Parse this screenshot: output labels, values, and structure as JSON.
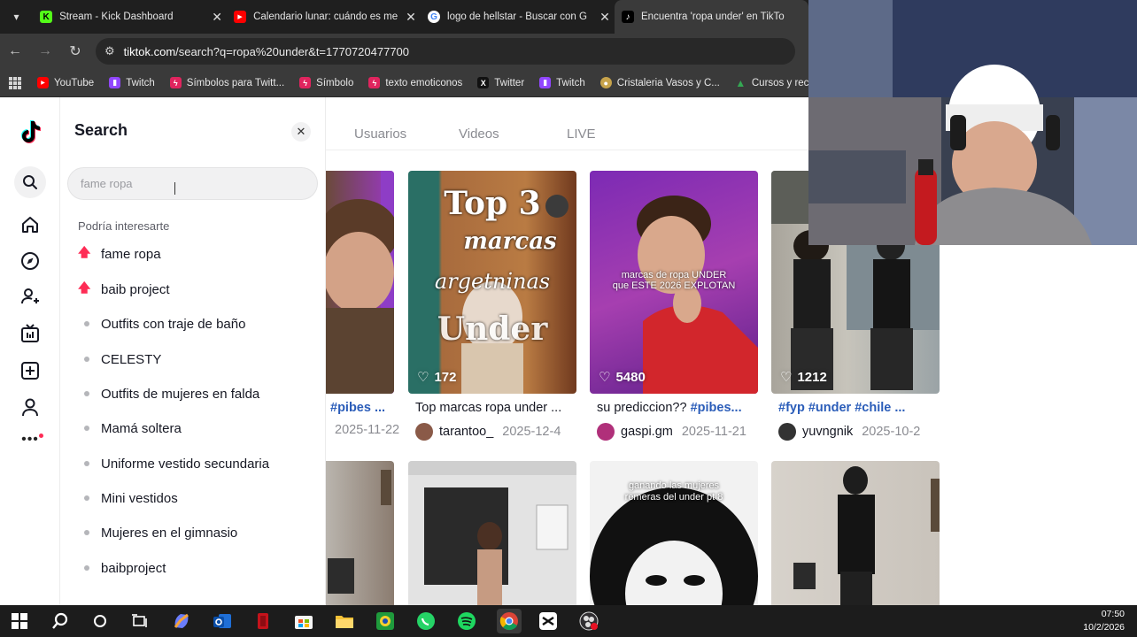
{
  "browser": {
    "tabs": [
      {
        "label": "Stream - Kick Dashboard",
        "icon": "kick-icon",
        "color": "#53fc18",
        "glyph": "K"
      },
      {
        "label": "Calendario lunar: cuándo es me",
        "icon": "youtube-icon",
        "color": "#ff0000",
        "glyph": "▶"
      },
      {
        "label": "logo de hellstar - Buscar con G",
        "icon": "google-icon",
        "color": "#ffffff",
        "glyph": "G"
      },
      {
        "label": "Encuentra 'ropa under' en TikTo",
        "icon": "tiktok-icon",
        "color": "#000000",
        "glyph": "♪"
      }
    ],
    "url_host": "tiktok.com",
    "url_path": "/search?q=ropa%20under&t=1770720477700",
    "bookmarks": [
      {
        "label": "YouTube",
        "icon": "youtube-icon",
        "color": "#ff0000",
        "glyph": "▶"
      },
      {
        "label": "Twitch",
        "icon": "twitch-icon",
        "color": "#9146ff",
        "glyph": "▮"
      },
      {
        "label": "Símbolos para Twitt...",
        "icon": "bolt-icon",
        "color": "#e0245e",
        "glyph": "ϟ"
      },
      {
        "label": "Símbolo",
        "icon": "bolt-icon",
        "color": "#e0245e",
        "glyph": "ϟ"
      },
      {
        "label": "texto emoticonos",
        "icon": "bolt-icon",
        "color": "#e0245e",
        "glyph": "ϟ"
      },
      {
        "label": "Twitter",
        "icon": "x-icon",
        "color": "#111111",
        "glyph": "X"
      },
      {
        "label": "Twitch",
        "icon": "twitch-icon",
        "color": "#9146ff",
        "glyph": "▮"
      },
      {
        "label": "Cristaleria Vasos y C...",
        "icon": "store-icon",
        "color": "#c7a34b",
        "glyph": "●"
      },
      {
        "label": "Cursos y rece",
        "icon": "drive-icon",
        "color": "#34a853",
        "glyph": "▲"
      }
    ]
  },
  "search_panel": {
    "title": "Search",
    "placeholder": "fame ropa",
    "suggest_title": "Podría interesarte",
    "suggestions": [
      {
        "label": "fame ropa",
        "trending": true
      },
      {
        "label": "baib project",
        "trending": true
      },
      {
        "label": "Outfits con traje de baño",
        "trending": false
      },
      {
        "label": "CELESTY",
        "trending": false
      },
      {
        "label": "Outfits de mujeres en falda",
        "trending": false
      },
      {
        "label": "Mamá soltera",
        "trending": false
      },
      {
        "label": "Uniforme vestido secundaria",
        "trending": false
      },
      {
        "label": "Mini vestidos",
        "trending": false
      },
      {
        "label": "Mujeres en el gimnasio",
        "trending": false
      },
      {
        "label": "baibproject",
        "trending": false
      }
    ]
  },
  "results": {
    "tabs": [
      "Usuarios",
      "Videos",
      "LIVE"
    ],
    "videos": [
      {
        "likes": "",
        "caption_tag": "#pibes ...",
        "caption_text": "",
        "user": "",
        "date": "2025-11-22"
      },
      {
        "likes": "172",
        "caption_tag": "",
        "caption_text": "Top marcas ropa under ...",
        "user": "tarantoo_",
        "date": "2025-12-4",
        "overlay": [
          "Top 3",
          "marcas",
          "argetninas",
          "Under"
        ]
      },
      {
        "likes": "5480",
        "caption_tag": "#pibes...",
        "caption_text": "su prediccion?? ",
        "user": "gaspi.gm",
        "date": "2025-11-21",
        "overlay": [
          "marcas de ropa UNDER",
          "que ESTE 2026 EXPLOTAN"
        ]
      },
      {
        "likes": "1212",
        "caption_tag": "#fyp #under #chile ...",
        "caption_text": "",
        "user": "yuvngnik",
        "date": "2025-10-2"
      }
    ],
    "row2_overlay": [
      "ganando las mujeres",
      "remeras del under pt 8"
    ]
  },
  "taskbar": {
    "time": "07:50",
    "date": "10/2/2026"
  }
}
